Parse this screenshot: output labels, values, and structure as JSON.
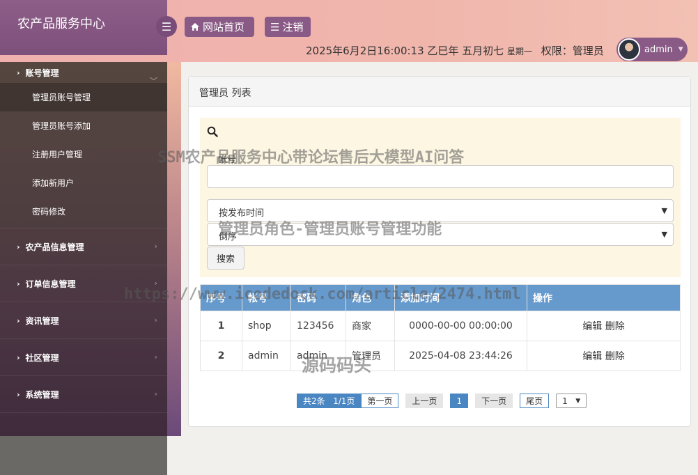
{
  "header": {
    "brand": "农产品服务中心",
    "home_label": "网站首页",
    "logout_label": "注销",
    "datetime": "2025年6月2日16:00:13 乙巳年 五月初七",
    "weekday": "星期一",
    "permission": "权限：管理员",
    "username": "admin"
  },
  "sidebar": {
    "groups": [
      {
        "label": "账号管理",
        "open": true,
        "items": [
          "管理员账号管理",
          "管理员账号添加",
          "注册用户管理",
          "添加新用户",
          "密码修改"
        ]
      },
      {
        "label": "农产品信息管理"
      },
      {
        "label": "订单信息管理"
      },
      {
        "label": "资讯管理"
      },
      {
        "label": "社区管理"
      },
      {
        "label": "系统管理"
      }
    ]
  },
  "panel": {
    "title": "管理员 列表",
    "search": {
      "account_label": "帐号",
      "account_value": "",
      "sort_field": "按发布时间",
      "sort_order": "倒序",
      "search_button": "搜索"
    },
    "table": {
      "headers": [
        "序号",
        "帐号",
        "密码",
        "角色",
        "添加时间",
        "操作"
      ],
      "rows": [
        {
          "no": "1",
          "account": "shop",
          "password": "123456",
          "role": "商家",
          "time": "0000-00-00 00:00:00",
          "edit": "编辑",
          "delete": "删除"
        },
        {
          "no": "2",
          "account": "admin",
          "password": "admin",
          "role": "管理员",
          "time": "2025-04-08 23:44:26",
          "edit": "编辑",
          "delete": "删除"
        }
      ]
    },
    "pagination": {
      "summary": "共2条   1/1页",
      "first": "第一页",
      "prev": "上一页",
      "current": "1",
      "next": "下一页",
      "last": "尾页",
      "page_select": "1"
    }
  },
  "watermarks": {
    "line1": "SSM农产品服务中心带论坛售后大模型AI问答",
    "line2": "管理员角色-管理员账号管理功能",
    "line3": "https://www.icodedock.com/article/2474.html",
    "line4": "源码码头"
  },
  "icons": {
    "menu": "menu-icon",
    "home": "home-icon",
    "list": "list-icon",
    "search": "search-icon",
    "chevron": "chevron-right-icon"
  },
  "colors": {
    "header_bg": "#efb0ae",
    "brand_bg": "#8d5e88",
    "button_bg": "#8a5a86",
    "table_header": "#6699cc",
    "search_bg": "#fdf6e3"
  }
}
